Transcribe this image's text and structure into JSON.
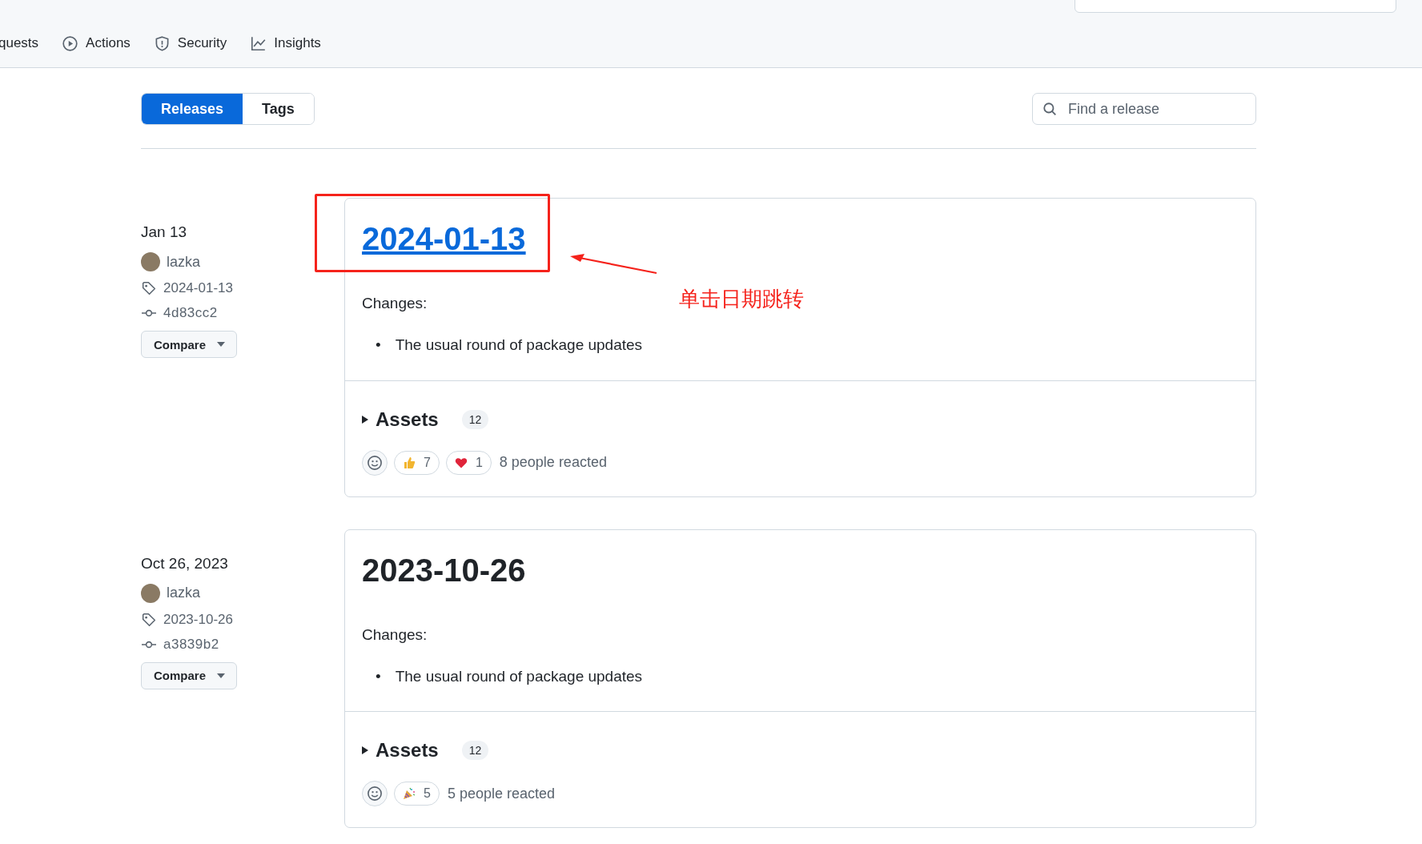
{
  "nav": {
    "tabs": [
      {
        "label": "quests",
        "kind": "pull"
      },
      {
        "label": "Actions",
        "kind": "play"
      },
      {
        "label": "Security",
        "kind": "shield"
      },
      {
        "label": "Insights",
        "kind": "graph"
      }
    ]
  },
  "subnav": {
    "tabs": [
      {
        "label": "Releases",
        "selected": true
      },
      {
        "label": "Tags",
        "selected": false
      }
    ],
    "search": {
      "placeholder": "Find a release"
    }
  },
  "releases": [
    {
      "date": "Jan 13",
      "author": "lazka",
      "tag": "2024-01-13",
      "commit": "4d83cc2",
      "compare": "Compare",
      "title": "2024-01-13",
      "title_link": true,
      "changes_label": "Changes:",
      "changes": [
        {
          "marker": "•",
          "text": "The usual round of package updates"
        }
      ],
      "assets_label": "Assets",
      "assets_count": "12",
      "reactions": [
        {
          "kind": "thumbsup",
          "count": "7"
        },
        {
          "kind": "heart",
          "count": "1"
        }
      ],
      "reacted": "8 people reacted"
    },
    {
      "date": "Oct 26, 2023",
      "author": "lazka",
      "tag": "2023-10-26",
      "commit": "a3839b2",
      "compare": "Compare",
      "title": "2023-10-26",
      "title_link": false,
      "changes_label": "Changes:",
      "changes": [
        {
          "marker": "•",
          "text": "The usual round of package updates"
        }
      ],
      "assets_label": "Assets",
      "assets_count": "12",
      "reactions": [
        {
          "kind": "party",
          "count": "5"
        }
      ],
      "reacted": "5 people reacted"
    }
  ],
  "annotation": {
    "text": "单击日期跳转"
  }
}
